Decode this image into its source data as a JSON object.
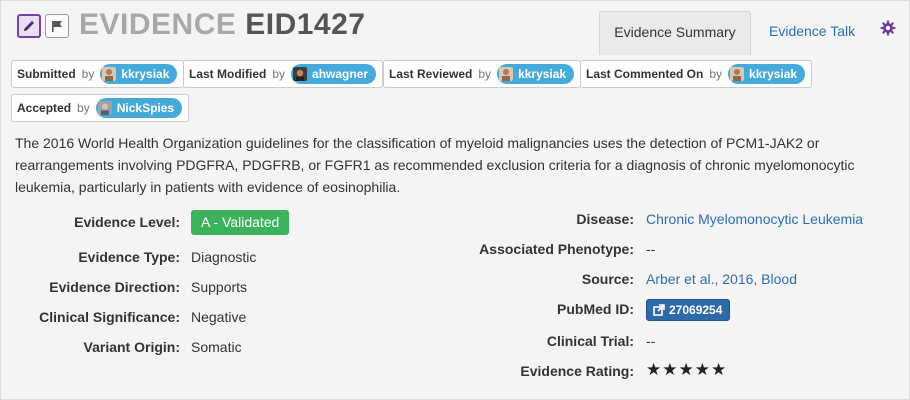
{
  "header": {
    "title_word": "EVIDENCE",
    "title_id": "EID1427",
    "tabs": [
      {
        "label": "Evidence Summary",
        "active": true
      },
      {
        "label": "Evidence Talk",
        "active": false
      }
    ],
    "icons": [
      "edit-icon",
      "flag-icon",
      "gear-icon"
    ]
  },
  "attribution": [
    {
      "label": "Submitted",
      "by": "by",
      "user": "kkrysiak"
    },
    {
      "label": "Last Modified",
      "by": "by",
      "user": "ahwagner"
    },
    {
      "label": "Last Reviewed",
      "by": "by",
      "user": "kkrysiak"
    },
    {
      "label": "Last Commented On",
      "by": "by",
      "user": "kkrysiak"
    },
    {
      "label": "Accepted",
      "by": "by",
      "user": "NickSpies"
    }
  ],
  "description": "The 2016 World Health Organization guidelines for the classification of myeloid malignancies uses the detection of PCM1-JAK2 or rearrangements involving PDGFRA, PDGFRB, or FGFR1 as recommended exclusion criteria for a diagnosis of chronic myelomonocytic leukemia, particularly in patients with evidence of eosinophilia.",
  "left_fields": [
    {
      "label": "Evidence Level:",
      "value": "A - Validated"
    },
    {
      "label": "Evidence Type:",
      "value": "Diagnostic"
    },
    {
      "label": "Evidence Direction:",
      "value": "Supports"
    },
    {
      "label": "Clinical Significance:",
      "value": "Negative"
    },
    {
      "label": "Variant Origin:",
      "value": "Somatic"
    }
  ],
  "right_fields": [
    {
      "label": "Disease:",
      "value": "Chronic Myelomonocytic Leukemia"
    },
    {
      "label": "Associated Phenotype:",
      "value": "--"
    },
    {
      "label": "Source:",
      "value": "Arber et al., 2016, Blood"
    },
    {
      "label": "PubMed ID:",
      "value": "27069254"
    },
    {
      "label": "Clinical Trial:",
      "value": "--"
    },
    {
      "label": "Evidence Rating:",
      "value": "★★★★★",
      "rating": 5,
      "max": 5
    }
  ],
  "colors": {
    "accent_purple": "#7a3fa8",
    "link_blue": "#2a6fb5",
    "user_pill": "#45a9d9",
    "level_green": "#3cb35a",
    "pubmed_blue": "#2f6aa8"
  }
}
